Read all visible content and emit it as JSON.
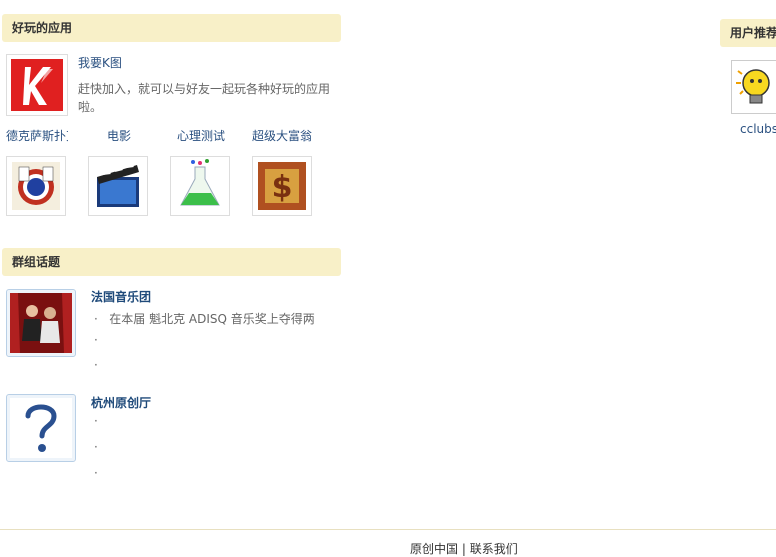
{
  "apps_section": {
    "title": "好玩的应用",
    "featured": {
      "icon": "k-letter-logo-icon",
      "name": "我要K图",
      "description": "赶快加入，就可以与好友一起玩各种好玩的应用啦。"
    },
    "apps": [
      {
        "label": "德克萨斯扑克",
        "icon": "poker-chips-icon"
      },
      {
        "label": "电影",
        "icon": "clapperboard-icon"
      },
      {
        "label": "心理测试",
        "icon": "flask-icon"
      },
      {
        "label": "超级大富翁",
        "icon": "money-bag-icon"
      }
    ]
  },
  "groups_section": {
    "title": "群组话题",
    "groups": [
      {
        "name": "法国音乐团",
        "avatar": "group-photo-icon",
        "topics": [
          "在本届 魁北克 ADISQ 音乐奖上夺得两",
          "",
          ""
        ]
      },
      {
        "name": "杭州原创厅",
        "avatar": "question-mark-icon",
        "topics": [
          "",
          "",
          ""
        ]
      }
    ]
  },
  "users_section": {
    "title": "用户推荐",
    "users": [
      {
        "name": "cclubs",
        "avatar": "lightbulb-avatar-icon"
      }
    ]
  },
  "footer": {
    "links": [
      "原创中国",
      "联系我们"
    ],
    "separator": "|"
  },
  "colors": {
    "section_header_bg": "#f8f0c8",
    "link": "#2a5080",
    "group_name": "#1f4a7a"
  }
}
